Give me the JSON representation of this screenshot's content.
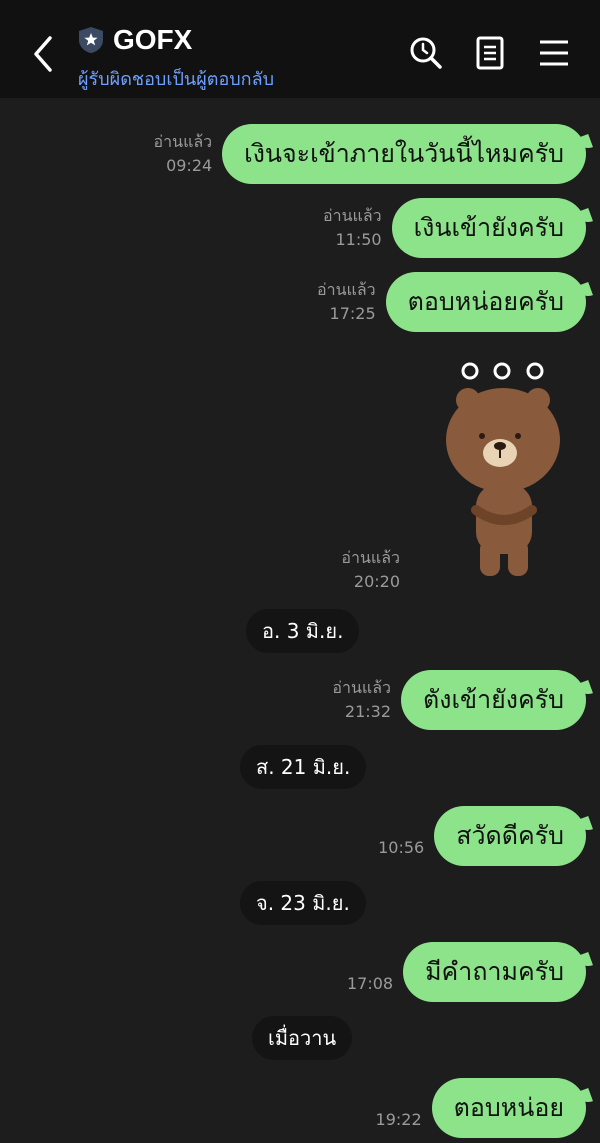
{
  "header": {
    "title": "GOFX",
    "subtitle": "ผู้รับผิดชอบเป็นผู้ตอบกลับ"
  },
  "messages": [
    {
      "text": "เงินจะเข้าภายในวันนี้ไหมครับ",
      "read": "อ่านแล้ว",
      "time": "09:24"
    },
    {
      "text": "เงินเข้ายังครับ",
      "read": "อ่านแล้ว",
      "time": "11:50"
    },
    {
      "text": "ตอบหน่อยครับ",
      "read": "อ่านแล้ว",
      "time": "17:25"
    },
    {
      "sticker": "brown-bear-sticker",
      "read": "อ่านแล้ว",
      "time": "20:20"
    },
    {
      "text": "ตังเข้ายังครับ",
      "read": "อ่านแล้ว",
      "time": "21:32"
    },
    {
      "text": "สวัดดีครับ",
      "time": "10:56"
    },
    {
      "text": "มีคำถามครับ",
      "time": "17:08"
    },
    {
      "text": "ตอบหน่อย",
      "time": "19:22"
    }
  ],
  "dates": [
    "อ. 3 มิ.ย.",
    "ส. 21 มิ.ย.",
    "จ. 23 มิ.ย.",
    "เมื่อวาน"
  ],
  "colors": {
    "bubble": "#8de38a",
    "background": "#1d1d1d",
    "header": "#111111",
    "subtitle": "#6ea0ff"
  },
  "icons": {
    "back": "chevron-left-icon",
    "shield": "shield-star-icon",
    "search": "search-clock-icon",
    "notes": "notes-icon",
    "menu": "hamburger-menu-icon"
  }
}
